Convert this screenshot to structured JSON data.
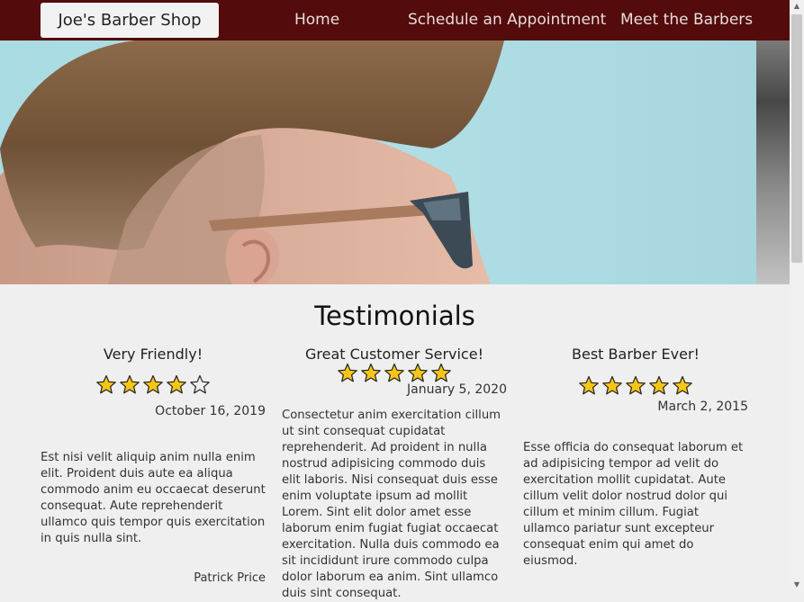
{
  "nav": {
    "brand": "Joe's Barber Shop",
    "links": [
      "Home",
      "Schedule an Appointment",
      "Meet the Barbers"
    ]
  },
  "hero": {
    "alt": "hero-photo"
  },
  "testimonials": {
    "title": "Testimonials",
    "cards": [
      {
        "title": "Very Friendly!",
        "rating": 4,
        "max_rating": 5,
        "date": "October 16, 2019",
        "body": "Est nisi velit aliquip anim nulla enim elit. Proident duis aute ea aliqua commodo anim eu occaecat deserunt consequat. Aute reprehenderit ullamco quis tempor quis exercitation in quis nulla sint.",
        "author": "Patrick Price"
      },
      {
        "title": "Great Customer Service!",
        "rating": 5,
        "max_rating": 5,
        "date": "January 5, 2020",
        "body": "Consectetur anim exercitation cillum ut sint consequat cupidatat reprehenderit. Ad proident in nulla nostrud adipisicing commodo duis elit laboris. Nisi consequat duis esse enim voluptate ipsum ad mollit Lorem. Sint elit dolor amet esse laborum enim fugiat fugiat occaecat exercitation. Nulla duis commodo ea sit incididunt irure commodo culpa dolor laborum ea anim. Sint ullamco duis sint consequat.",
        "author": ""
      },
      {
        "title": "Best Barber Ever!",
        "rating": 5,
        "max_rating": 5,
        "date": "March 2, 2015",
        "body": "Esse officia do consequat laborum et ad adipisicing tempor ad velit do exercitation mollit cupidatat. Aute cillum velit dolor nostrud dolor qui cillum et minim cillum. Fugiat ullamco pariatur sunt excepteur consequat enim qui amet do eiusmod.",
        "author": ""
      }
    ]
  },
  "colors": {
    "nav_bg": "#530b0c",
    "star_fill": "#f5c518",
    "star_stroke": "#222222"
  }
}
